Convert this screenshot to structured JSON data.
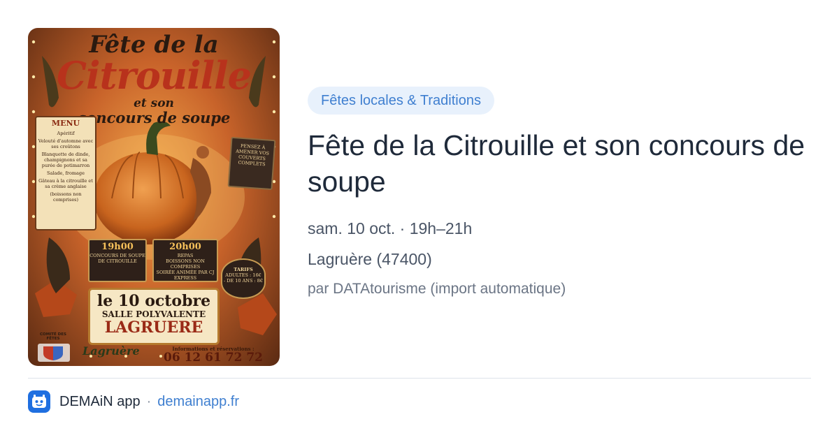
{
  "poster": {
    "title_line1": "Fête de la",
    "title_line2": "Citrouille",
    "title_line3": "et son",
    "title_line4": "concours de soupe",
    "menu": {
      "heading": "MENU",
      "items": [
        "Apéritif",
        "Velouté d'automne avec ses croûtons",
        "Blanquette de dinde, champignons et sa purée de potimarron",
        "Salade, fromage",
        "Gâteau à la citrouille et sa crème anglaise",
        "(boissons non comprises)"
      ]
    },
    "sign": "PENSEZ À AMENER VOS COUVERTS COMPLETS",
    "board_contest": {
      "time": "19h00",
      "text": "CONCOURS DE SOUPE DE CITROUILLE"
    },
    "board_meal": {
      "time": "20h00",
      "title": "REPAS",
      "note": "BOISSONS NON COMPRISES",
      "text": "SOIRÉE ANIMÉE PAR CJ EXPRESS"
    },
    "tarifs": {
      "heading": "TARIFS",
      "adults": "ADULTES : 16€",
      "kids": "- DE 10 ANS : 8€"
    },
    "date": "le 10 octobre",
    "venue": "SALLE POLYVALENTE",
    "town": "LAGRUERE",
    "info_label": "Informations et réservations :",
    "phone": "06 12 61 72 72",
    "signature": "Lagruère",
    "committee": "COMITÉ DES FÊTES"
  },
  "event": {
    "category": "Fêtes locales & Traditions",
    "title": "Fête de la Citrouille et son concours de soupe",
    "when": "sam. 10 oct. · 19h–21h",
    "where": "Lagruère (47400)",
    "source": "par DATAtourisme (import automatique)"
  },
  "footer": {
    "app_icon": "demain-app-icon",
    "app_name": "DEMAiN app",
    "separator": "·",
    "link": "demainapp.fr"
  },
  "colors": {
    "chip_bg": "#e8f1fc",
    "chip_text": "#3f7fd0",
    "link": "#3f7fd0",
    "app_icon_bg": "#1f6fe0"
  }
}
